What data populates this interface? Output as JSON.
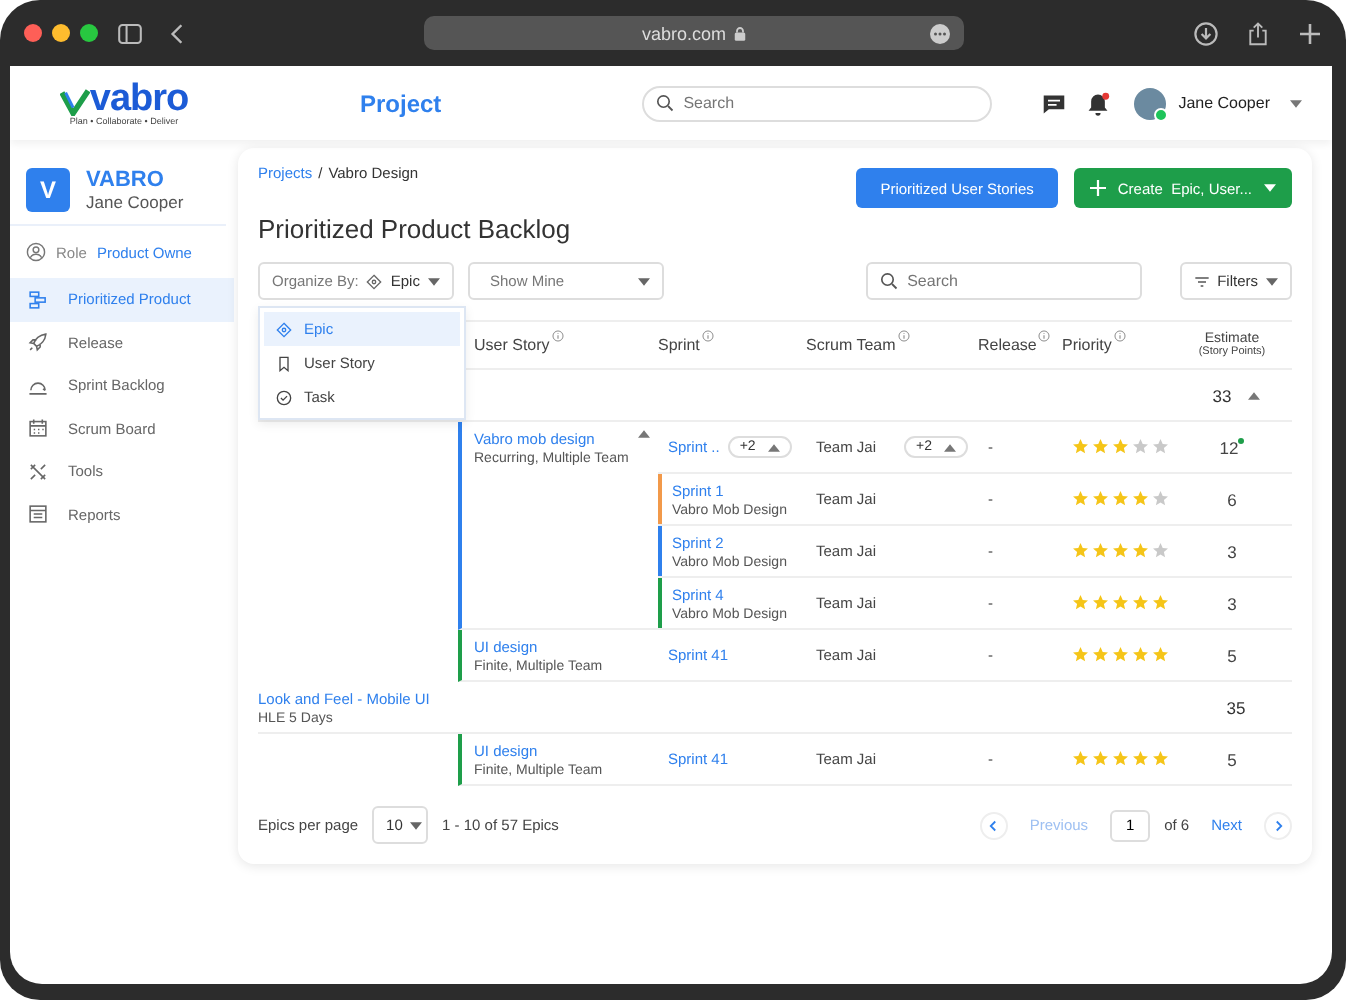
{
  "browser": {
    "url": "vabro.com"
  },
  "header": {
    "logo_text": "vabro",
    "tagline": "Plan • Collaborate • Deliver",
    "title": "Project",
    "search_placeholder": "Search",
    "notification_unread": true,
    "user_name": "Jane Cooper",
    "user_online": true
  },
  "sidebar": {
    "org_initial": "V",
    "org_name": "VABRO",
    "user_name": "Jane Cooper",
    "role_label": "Role",
    "role_value": "Product Owne",
    "items": [
      {
        "label": "Prioritized Product",
        "selected": true
      },
      {
        "label": "Release",
        "selected": false
      },
      {
        "label": "Sprint Backlog",
        "selected": false
      },
      {
        "label": "Scrum Board",
        "selected": false
      },
      {
        "label": "Tools",
        "selected": false
      },
      {
        "label": "Reports",
        "selected": false
      }
    ]
  },
  "breadcrumb": {
    "parent": "Projects",
    "separator": "/",
    "current": "Vabro Design"
  },
  "page_title": "Prioritized Product Backlog",
  "actions": [
    {
      "label": "Prioritized User Stories",
      "kind": "primary"
    },
    {
      "label": "Create  Epic, User...",
      "kind": "create"
    }
  ],
  "toolbar": {
    "organize_label": "Organize By:",
    "organize_value": "Epic",
    "show_mine": "Show Mine",
    "search_placeholder": "Search",
    "filters": "Filters"
  },
  "organize_menu": [
    {
      "label": "Epic",
      "selected": true
    },
    {
      "label": "User Story",
      "selected": false
    },
    {
      "label": "Task",
      "selected": false
    }
  ],
  "table": {
    "columns": [
      {
        "label": "User Story",
        "info": true
      },
      {
        "label": "Sprint",
        "info": true
      },
      {
        "label": "Scrum Team",
        "info": true
      },
      {
        "label": "Release",
        "info": true
      },
      {
        "label": "Priority",
        "info": true
      },
      {
        "label": "Estimate",
        "sublabel": "(Story Points)",
        "info": false
      }
    ],
    "epics": [
      {
        "total": "33",
        "expanded": true,
        "stories": [
          {
            "title": "Vabro mob design",
            "detail": "Recurring, Multiple Team",
            "color": "#2f80ed",
            "expanded": true,
            "summary": {
              "sprint": "Sprint ..",
              "sprint_more": "+2",
              "team": "Team Jai",
              "team_more": "+2",
              "release": "-",
              "stars": 3,
              "estimate": "12",
              "updated": true
            },
            "sprints": [
              {
                "name": "Sprint 1",
                "project": "Vabro Mob Design",
                "color": "#f2994a",
                "team": "Team Jai",
                "release": "-",
                "stars": 4,
                "estimate": "6"
              },
              {
                "name": "Sprint 2",
                "project": "Vabro Mob Design",
                "color": "#2f80ed",
                "team": "Team Jai",
                "release": "-",
                "stars": 4,
                "estimate": "3"
              },
              {
                "name": "Sprint 4",
                "project": "Vabro Mob Design",
                "color": "#1e9e4a",
                "team": "Team Jai",
                "release": "-",
                "stars": 5,
                "estimate": "3"
              }
            ]
          },
          {
            "title": "UI design",
            "detail": "Finite, Multiple Team",
            "color": "#1e9e4a",
            "sprints": [
              {
                "name": "Sprint 41",
                "team": "Team Jai",
                "release": "-",
                "stars": 5,
                "estimate": "5"
              }
            ]
          }
        ]
      },
      {
        "name": "Look and Feel - Mobile UI",
        "detail": "HLE 5 Days",
        "total": "35",
        "stories": [
          {
            "title": "UI design",
            "detail": "Finite, Multiple Team",
            "color": "#1e9e4a",
            "sprints": [
              {
                "name": "Sprint 41",
                "team": "Team Jai",
                "release": "-",
                "stars": 5,
                "estimate": "5"
              }
            ]
          }
        ]
      }
    ]
  },
  "pagination": {
    "per_page_label": "Epics per page",
    "per_page": "10",
    "range": "1 - 10 of 57 Epics",
    "previous": "Previous",
    "previous_disabled": true,
    "page": "1",
    "of": "of 6",
    "next": "Next"
  }
}
